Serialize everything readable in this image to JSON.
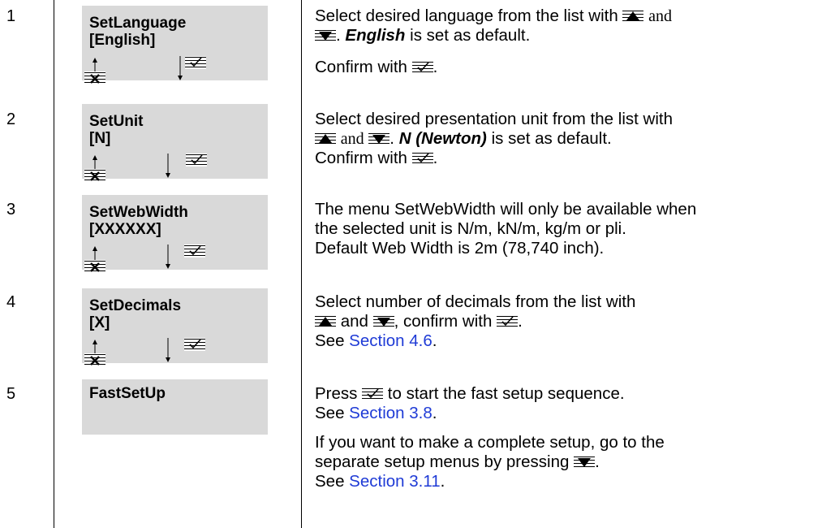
{
  "rows": [
    {
      "step": "1",
      "screen": {
        "line1": "SetLanguage",
        "line2": "[English]"
      },
      "p1": {
        "a": "Select desired language from the list with ",
        "and": "and",
        "c": ". ",
        "bold": "English",
        "d": " is set as default."
      },
      "p2": {
        "a": "Confirm with ",
        "b": "."
      }
    },
    {
      "step": "2",
      "screen": {
        "line1": "SetUnit",
        "line2": "[N]"
      },
      "p1": {
        "a": "Select desired presentation unit from the list with",
        "and": "and",
        "c": ". ",
        "bold": "N (Newton)",
        "d": " is set as default."
      },
      "p2": {
        "a": "Confirm with ",
        "b": "."
      }
    },
    {
      "step": "3",
      "screen": {
        "line1": "SetWebWidth",
        "line2": "[XXXXXX]"
      },
      "p1": {
        "l1": "The menu SetWebWidth will only be available when",
        "l2": "the selected unit is N/m, kN/m, kg/m or pli.",
        "l3": "Default Web Width is 2m (78,740 inch)."
      }
    },
    {
      "step": "4",
      "screen": {
        "line1": "SetDecimals",
        "line2": "[X]"
      },
      "p1": {
        "l1": "Select number of decimals from the list with",
        "and": "and",
        "c": ", confirm with ",
        "d": "."
      },
      "p2": {
        "see": "See ",
        "link": "Section 4.6",
        "end": "."
      }
    },
    {
      "step": "5",
      "screen": {
        "line1": "FastSetUp",
        "line2": ""
      },
      "p1": {
        "a": "Press ",
        "b": " to start the fast setup sequence."
      },
      "p2": {
        "see": "See ",
        "link": "Section 3.8",
        "end": "."
      },
      "p3": {
        "l1": "If you want to make a complete setup, go to the",
        "l2": "separate setup menus by pressing ",
        "l2end": "."
      },
      "p4": {
        "see": "See ",
        "link": "Section 3.11",
        "end": "."
      }
    }
  ],
  "icons": {
    "up": "arrow-up-button-icon",
    "down": "arrow-down-button-icon",
    "ok": "checkmark-button-icon",
    "esc": "escape-x-icon"
  }
}
